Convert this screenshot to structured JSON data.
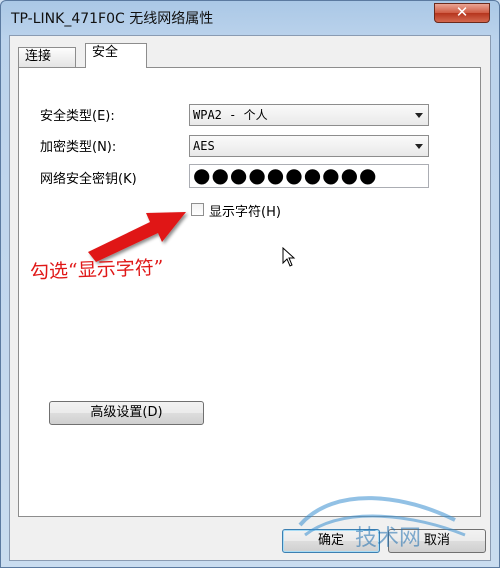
{
  "window": {
    "title": "TP-LINK_471F0C 无线网络属性",
    "close_label": "✕"
  },
  "tabs": [
    {
      "label": "连接",
      "active": false
    },
    {
      "label": "安全",
      "active": true
    }
  ],
  "form": {
    "security_type_label": "安全类型(E):",
    "security_type_value": "WPA2 - 个人",
    "encryption_type_label": "加密类型(N):",
    "encryption_type_value": "AES",
    "network_key_label": "网络安全密钥(K)",
    "network_key_value": "●●●●●●●●●●",
    "show_characters_label": "显示字符(H)",
    "show_characters_checked": false,
    "advanced_settings_label": "高级设置(D)"
  },
  "footer": {
    "ok_label": "确定",
    "cancel_label": "取消"
  },
  "annotation": {
    "text": "勾选“显示字符”",
    "color": "#e01818"
  },
  "watermark": {
    "text": "技术网"
  },
  "colors": {
    "accent": "#e01818",
    "title_bar": "#bcd3ec"
  }
}
